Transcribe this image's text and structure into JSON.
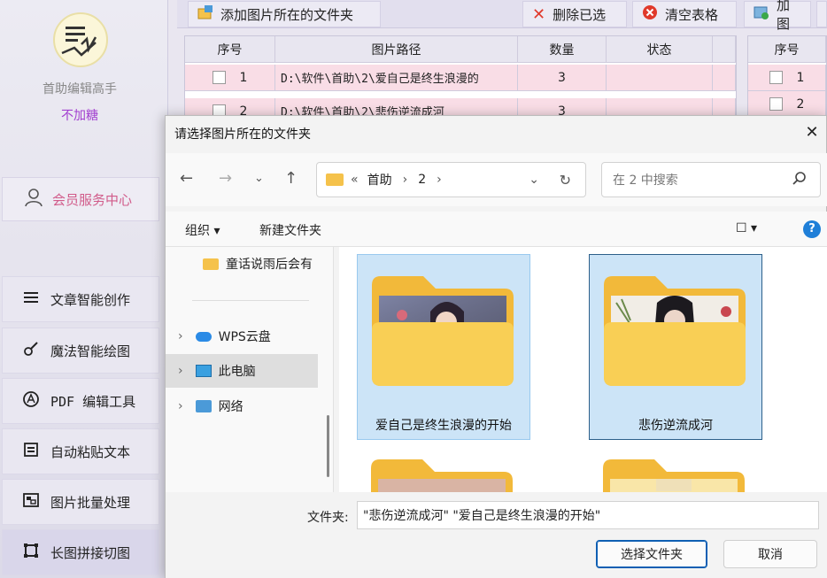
{
  "app": {
    "name": "首助编辑高手",
    "subtitle": "不加糖"
  },
  "sidebar": {
    "member_label": "会员服务中心",
    "items": [
      {
        "label": "文章智能创作",
        "icon": "list-icon"
      },
      {
        "label": "魔法智能绘图",
        "icon": "brush-icon"
      },
      {
        "label": "PDF 编辑工具",
        "icon": "pdf-icon"
      },
      {
        "label": "自动粘贴文本",
        "icon": "paste-icon"
      },
      {
        "label": "图片批量处理",
        "icon": "image-icon"
      },
      {
        "label": "长图拼接切图",
        "icon": "crop-icon"
      }
    ]
  },
  "toolbar": {
    "add_folder": "添加图片所在的文件夹",
    "delete_selected": "删除已选",
    "clear_table": "清空表格",
    "add_image": "加图"
  },
  "table": {
    "headers": [
      "序号",
      "图片路径",
      "数量",
      "状态"
    ],
    "rows": [
      {
        "index": "1",
        "path": "D:\\软件\\首助\\2\\爱自己是终生浪漫的",
        "count": "3",
        "status": ""
      },
      {
        "index": "2",
        "path": "D:\\软件\\首助\\2\\悲伤逆流成河",
        "count": "3",
        "status": ""
      }
    ]
  },
  "table2": {
    "header": "序号",
    "rows": [
      "1",
      "2"
    ]
  },
  "dialog": {
    "title": "请选择图片所在的文件夹",
    "breadcrumb": [
      "首助",
      "2"
    ],
    "search_placeholder": "在 2 中搜索",
    "organize": "组织",
    "new_folder": "新建文件夹",
    "tree": [
      {
        "label": "童话说雨后会有"
      },
      {
        "label": "WPS云盘"
      },
      {
        "label": "此电脑"
      },
      {
        "label": "网络"
      }
    ],
    "folders": [
      {
        "name": "爱自己是终生浪漫的开始"
      },
      {
        "name": "悲伤逆流成河"
      }
    ],
    "folder_field_label": "文件夹:",
    "folder_field_value": "\"悲伤逆流成河\" \"爱自己是终生浪漫的开始\"",
    "select_button": "选择文件夹",
    "cancel_button": "取消"
  },
  "colors": {
    "accent": "#0f5fb3",
    "selection": "#cce4f7",
    "row_highlight": "#f9dde6",
    "member": "#d15b8a",
    "subtitle": "#a23ed0"
  }
}
